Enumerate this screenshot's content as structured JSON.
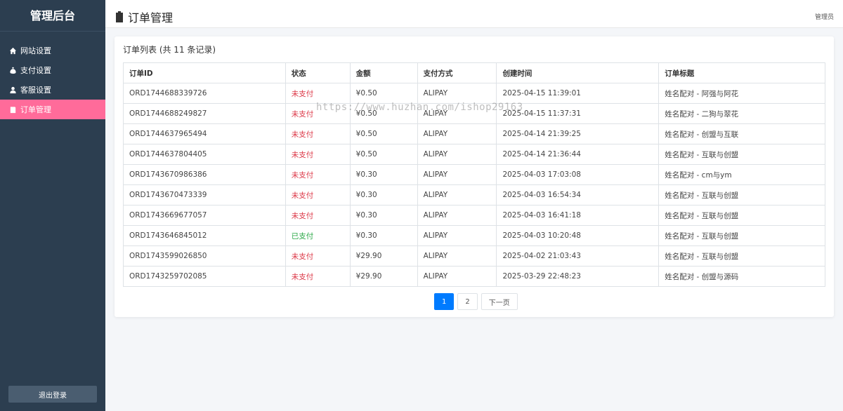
{
  "sidebar": {
    "brand": "管理后台",
    "items": [
      {
        "label": "网站设置",
        "icon": "home-icon"
      },
      {
        "label": "支付设置",
        "icon": "money-bag-icon"
      },
      {
        "label": "客服设置",
        "icon": "user-headset-icon"
      },
      {
        "label": "订单管理",
        "icon": "clipboard-icon",
        "active": true
      }
    ],
    "logout_label": "退出登录"
  },
  "header": {
    "title": "订单管理",
    "user": "管理员"
  },
  "orders": {
    "card_title": "订单列表 (共 11 条记录)",
    "columns": [
      "订单ID",
      "状态",
      "金额",
      "支付方式",
      "创建时间",
      "订单标题"
    ],
    "rows": [
      [
        "ORD1744688339726",
        "未支付",
        "¥0.50",
        "ALIPAY",
        "2025-04-15 11:39:01",
        "姓名配对 - 阿强与阿花"
      ],
      [
        "ORD1744688249827",
        "未支付",
        "¥0.50",
        "ALIPAY",
        "2025-04-15 11:37:31",
        "姓名配对 - 二狗与翠花"
      ],
      [
        "ORD1744637965494",
        "未支付",
        "¥0.50",
        "ALIPAY",
        "2025-04-14 21:39:25",
        "姓名配对 - 创盟与互联"
      ],
      [
        "ORD1744637804405",
        "未支付",
        "¥0.50",
        "ALIPAY",
        "2025-04-14 21:36:44",
        "姓名配对 - 互联与创盟"
      ],
      [
        "ORD1743670986386",
        "未支付",
        "¥0.30",
        "ALIPAY",
        "2025-04-03 17:03:08",
        "姓名配对 - cm与ym"
      ],
      [
        "ORD1743670473339",
        "未支付",
        "¥0.30",
        "ALIPAY",
        "2025-04-03 16:54:34",
        "姓名配对 - 互联与创盟"
      ],
      [
        "ORD1743669677057",
        "未支付",
        "¥0.30",
        "ALIPAY",
        "2025-04-03 16:41:18",
        "姓名配对 - 互联与创盟"
      ],
      [
        "ORD1743646845012",
        "已支付",
        "¥0.30",
        "ALIPAY",
        "2025-04-03 10:20:48",
        "姓名配对 - 互联与创盟"
      ],
      [
        "ORD1743599026850",
        "未支付",
        "¥29.90",
        "ALIPAY",
        "2025-04-02 21:03:43",
        "姓名配对 - 互联与创盟"
      ],
      [
        "ORD1743259702085",
        "未支付",
        "¥29.90",
        "ALIPAY",
        "2025-03-29 22:48:23",
        "姓名配对 - 创盟与源码"
      ]
    ],
    "status_colors": {
      "未支付": "#dc3545",
      "已支付": "#28a745"
    }
  },
  "pagination": {
    "pages": [
      "1",
      "2"
    ],
    "current": "1",
    "next_label": "下一页"
  },
  "watermark": "https://www.huzhan.com/ishop29163"
}
